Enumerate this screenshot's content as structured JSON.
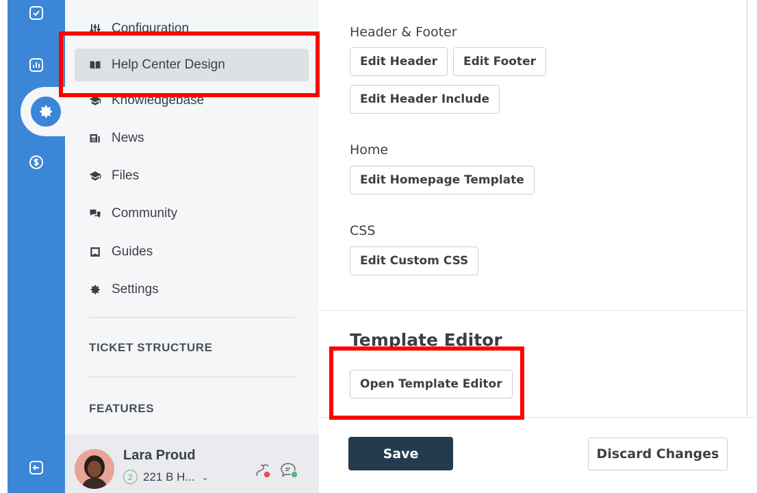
{
  "rail": {
    "items": [
      {
        "icon": "check-square-icon"
      },
      {
        "icon": "bar-chart-icon"
      },
      {
        "icon": "gear-icon",
        "active": true
      },
      {
        "icon": "dollar-circle-icon"
      }
    ],
    "bottom_icon": "collapse-arrow-icon"
  },
  "nav": {
    "items": [
      {
        "label": "Configuration",
        "icon": "sliders-icon"
      },
      {
        "label": "Help Center Design",
        "icon": "open-book-icon",
        "active": true
      },
      {
        "label": "Knowledgebase",
        "icon": "graduation-cap-icon"
      },
      {
        "label": "News",
        "icon": "news-icon"
      },
      {
        "label": "Files",
        "icon": "graduation-cap-icon"
      },
      {
        "label": "Community",
        "icon": "chat-bubbles-icon"
      },
      {
        "label": "Guides",
        "icon": "book-square-icon"
      },
      {
        "label": "Settings",
        "icon": "gear-icon"
      }
    ],
    "headings": [
      "TICKET STRUCTURE",
      "FEATURES"
    ]
  },
  "user": {
    "name": "Lara Proud",
    "badge": "2",
    "sub": "221 B H...",
    "caret": "⌄"
  },
  "main": {
    "header_footer": {
      "label": "Header & Footer",
      "buttons": [
        "Edit Header",
        "Edit Footer",
        "Edit Header Include"
      ]
    },
    "home": {
      "label": "Home",
      "buttons": [
        "Edit Homepage Template"
      ]
    },
    "css": {
      "label": "CSS",
      "buttons": [
        "Edit Custom CSS"
      ]
    },
    "template_editor": {
      "title": "Template Editor",
      "button": "Open Template Editor"
    },
    "footer": {
      "save": "Save",
      "discard": "Discard Changes"
    }
  },
  "colors": {
    "rail_blue": "#3c86d8",
    "save_bg": "#243b4f",
    "highlight": "#ff0000",
    "status_green": "#53b87a",
    "status_red": "#e84b4b"
  }
}
